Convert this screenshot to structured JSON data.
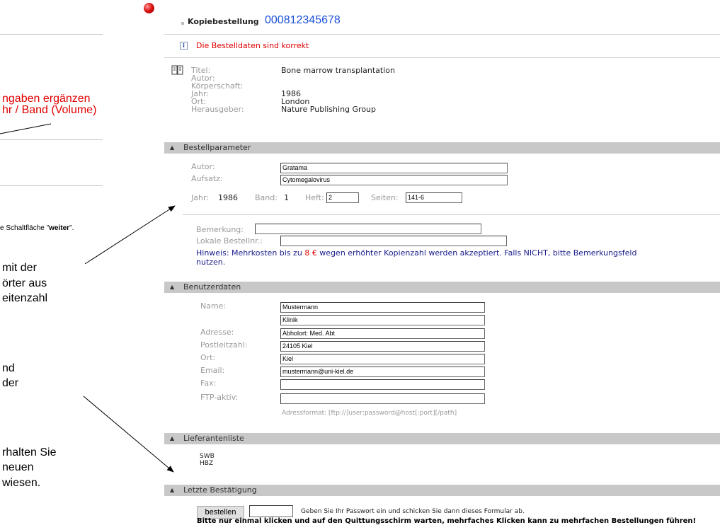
{
  "annotations": {
    "line1": "ngaben ergänzen",
    "line2": "hr / Band (Volume)",
    "small_text_prefix": "e Schaltfläche \"",
    "small_text_bold": "weiter",
    "small_text_suffix": "\".",
    "block1": [
      "mit der",
      "örter aus",
      "eitenzahl"
    ],
    "block2": [
      "nd",
      "der"
    ],
    "block3": [
      "rhalten Sie",
      "neuen",
      "wiesen."
    ]
  },
  "header": {
    "title": "Kopiebestellung",
    "order_number": "000812345678",
    "status_message": "Die Bestelldaten sind korrekt"
  },
  "record": {
    "labels": [
      "Titel:",
      "Autor:",
      "Körperschaft:",
      "Jahr:",
      "Ort:",
      "Herausgeber:"
    ],
    "titel": "Bone marrow transplantation",
    "autor": "",
    "koerperschaft": "",
    "jahr": "1986",
    "ort": "London",
    "herausgeber": "Nature Publishing Group"
  },
  "bestellparameter": {
    "heading": "Bestellparameter",
    "autor_label": "Autor:",
    "autor_value": "Gratama",
    "aufsatz_label": "Aufsatz:",
    "aufsatz_value": "Cytomegalovirus",
    "jahr_label": "Jahr:",
    "jahr_value": "1986",
    "band_label": "Band:",
    "band_value": "1",
    "heft_label": "Heft:",
    "heft_value": "2",
    "seiten_label": "Seiten:",
    "seiten_value": "141-6"
  },
  "bemerkung": {
    "bemerkung_label": "Bemerkung:",
    "bemerkung_value": "",
    "lokale_label": "Lokale Bestellnr.:",
    "lokale_value": "",
    "hint_prefix": "Hinweis: Mehrkosten bis zu ",
    "hint_amount": "8 €",
    "hint_suffix": " wegen erhöhter Kopienzahl werden akzeptiert. Falls NICHT, bitte Bemerkungsfeld",
    "hint_line2": "nutzen."
  },
  "benutzerdaten": {
    "heading": "Benutzerdaten",
    "name_label": "Name:",
    "name_value": "Mustermann",
    "name2_value": "Klinik",
    "adresse_label": "Adresse:",
    "adresse_value": "Abholort: Med. Abt",
    "plz_label": "Postleitzahl:",
    "plz_value": "24105 Kiel",
    "ort_label": "Ort:",
    "ort_value": "Kiel",
    "email_label": "Email:",
    "email_value": "mustermann@uni-kiel.de",
    "fax_label": "Fax:",
    "fax_value": "",
    "ftp_label": "FTP-aktiv:",
    "ftp_value": "",
    "format_hint": "Adressformat: [ftp://]user:password@host[:port][/path]"
  },
  "lieferanten": {
    "heading": "Lieferantenliste",
    "items": [
      "SWB",
      "HBZ"
    ]
  },
  "bestaetigung": {
    "heading": "Letzte Bestätigung",
    "button_label": "bestellen",
    "password_value": "",
    "instruction": "Geben Sie Ihr Passwort ein und schicken Sie dann dieses Formular ab.",
    "warning": "Bitte nur einmal klicken und auf den Quittungsschirm warten, mehrfaches Klicken kann zu mehrfachen Bestellungen führen!"
  }
}
